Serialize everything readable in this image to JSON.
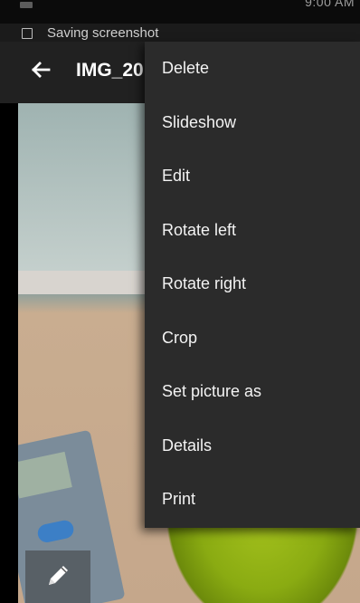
{
  "status_bar": {
    "partial_text": "9:00 AM"
  },
  "notification": {
    "text": "Saving screenshot"
  },
  "app_bar": {
    "title": "IMG_20"
  },
  "menu": {
    "items": [
      {
        "label": "Delete"
      },
      {
        "label": "Slideshow"
      },
      {
        "label": "Edit"
      },
      {
        "label": "Rotate left"
      },
      {
        "label": "Rotate right"
      },
      {
        "label": "Crop"
      },
      {
        "label": "Set picture as"
      },
      {
        "label": "Details"
      },
      {
        "label": "Print"
      }
    ]
  },
  "icons": {
    "back": "arrow-back-icon",
    "notification": "screenshot-icon",
    "edit": "pencil-icon"
  },
  "colors": {
    "app_bar": "#212121",
    "menu_bg": "#2b2b2b",
    "menu_text": "#f3f3f3"
  }
}
